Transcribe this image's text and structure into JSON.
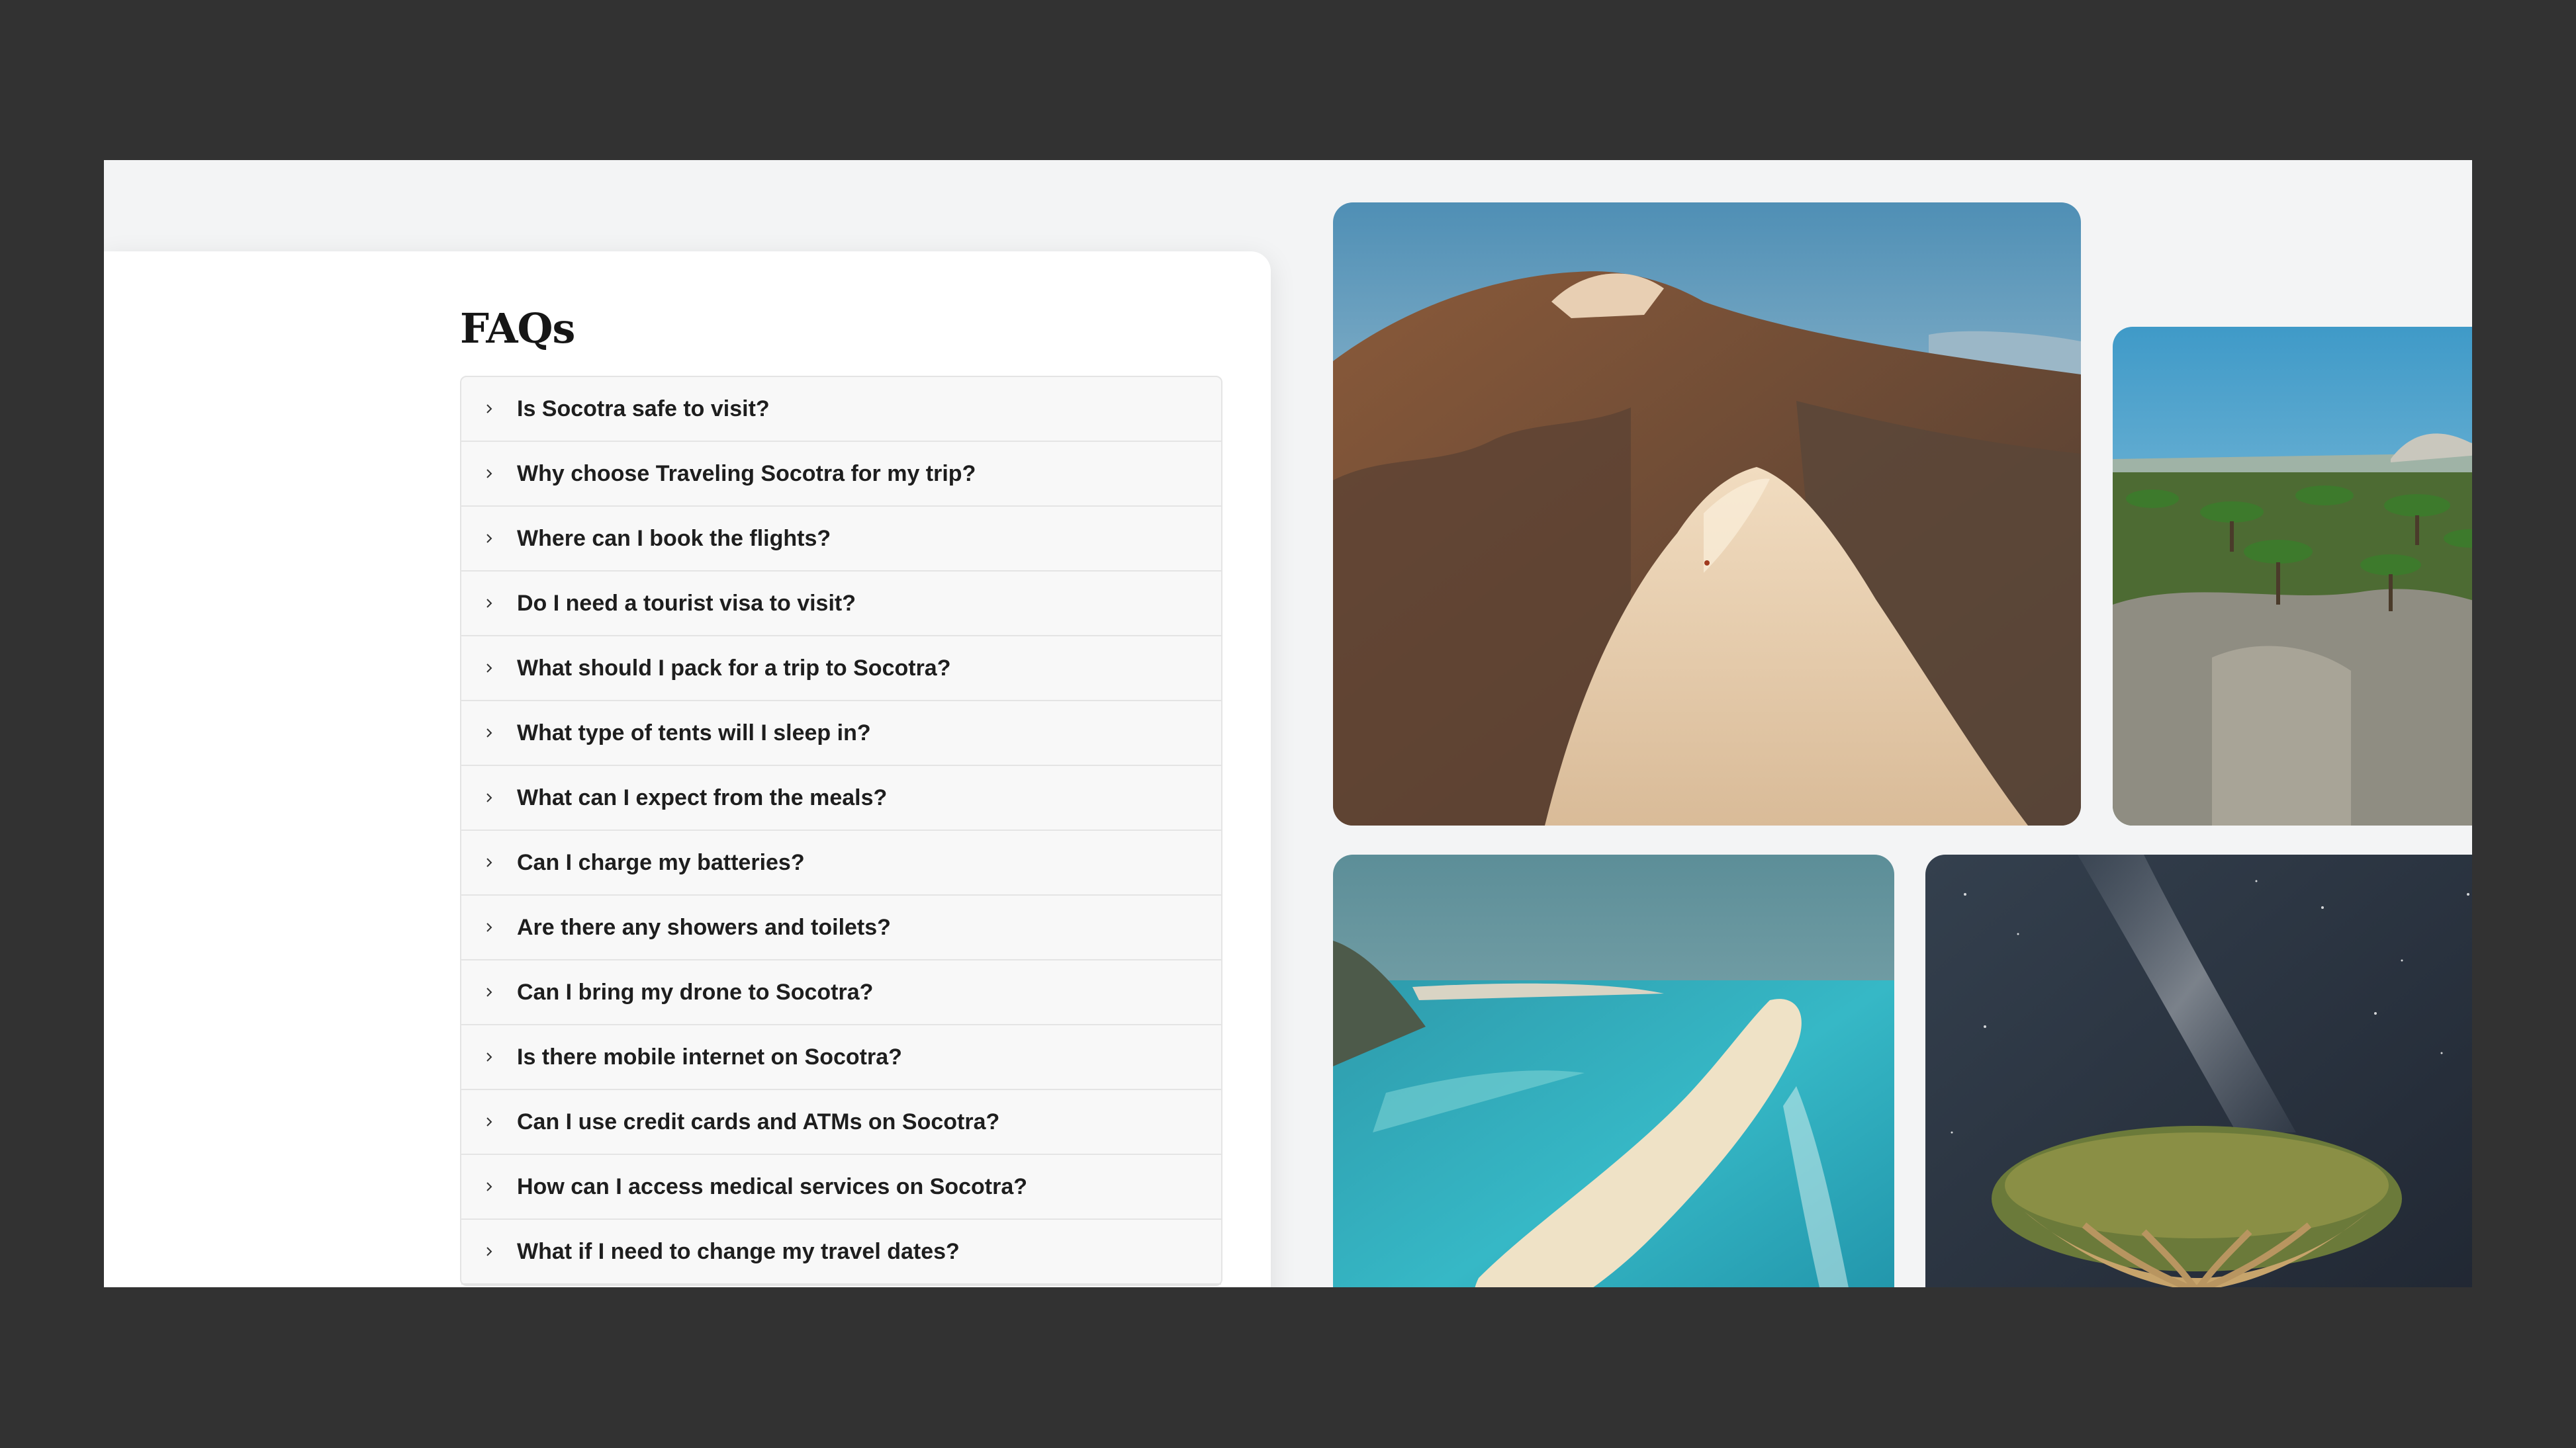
{
  "faq": {
    "title": "FAQs",
    "items": [
      "Is Socotra safe to visit?",
      "Why choose Traveling Socotra for my trip?",
      "Where can I book the flights?",
      "Do I need a tourist visa to visit?",
      "What should I pack for a trip to Socotra?",
      "What type of tents will I sleep in?",
      "What can I expect from the meals?",
      "Can I charge my batteries?",
      "Are there any showers and toilets?",
      "Can I bring my drone to Socotra?",
      "Is there mobile internet on Socotra?",
      "Can I use credit cards and ATMs on Socotra?",
      "How can I access medical services on Socotra?",
      "What if I need to change my travel dates?"
    ]
  },
  "gallery": {
    "photos": [
      "sand-dune-mountain-photo",
      "dragon-blood-tree-forest-photo",
      "turquoise-sandbar-beach-photo",
      "dragon-tree-milky-way-photo"
    ]
  },
  "colors": {
    "outer_background": "#323232",
    "page_background": "#f3f4f5",
    "panel_background": "#ffffff",
    "faq_item_background": "#f8f8f8",
    "text": "#1e1e1e"
  }
}
